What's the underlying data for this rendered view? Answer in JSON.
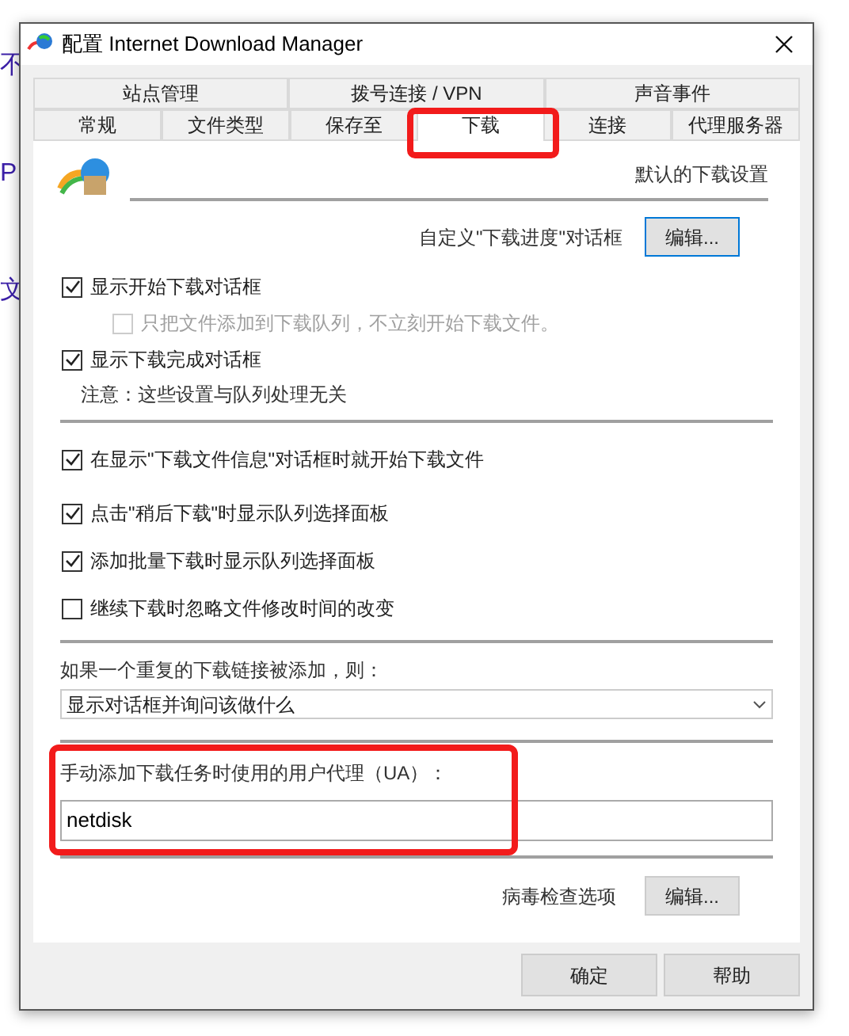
{
  "background_fragments": [
    "不",
    "P",
    "文"
  ],
  "window": {
    "title": "配置 Internet Download Manager"
  },
  "tab_rows": [
    [
      {
        "label": "站点管理",
        "selected": false,
        "highlighted": false
      },
      {
        "label": "拨号连接 / VPN",
        "selected": false,
        "highlighted": false
      },
      {
        "label": "声音事件",
        "selected": false,
        "highlighted": false
      }
    ],
    [
      {
        "label": "常规",
        "selected": false,
        "highlighted": false
      },
      {
        "label": "文件类型",
        "selected": false,
        "highlighted": false
      },
      {
        "label": "保存至",
        "selected": false,
        "highlighted": false
      },
      {
        "label": "下载",
        "selected": true,
        "highlighted": true
      },
      {
        "label": "连接",
        "selected": false,
        "highlighted": false
      },
      {
        "label": "代理服务器",
        "selected": false,
        "highlighted": false
      }
    ]
  ],
  "heading": "默认的下载设置",
  "progress_dialog": {
    "label": "自定义\"下载进度\"对话框",
    "button": "编辑...",
    "default": true
  },
  "group1": [
    {
      "label": "显示开始下载对话框",
      "checked": true,
      "disabled": false,
      "indented": false
    },
    {
      "label": "只把文件添加到下载队列，不立刻开始下载文件。",
      "checked": false,
      "disabled": true,
      "indented": true
    },
    {
      "label": "显示下载完成对话框",
      "checked": true,
      "disabled": false,
      "indented": false
    }
  ],
  "note": "注意：这些设置与队列处理无关",
  "group2": [
    {
      "label": "在显示\"下载文件信息\"对话框时就开始下载文件",
      "checked": true,
      "disabled": false,
      "indented": false
    },
    {
      "label": "点击\"稍后下载\"时显示队列选择面板",
      "checked": true,
      "disabled": false,
      "indented": false
    },
    {
      "label": "添加批量下载时显示队列选择面板",
      "checked": true,
      "disabled": false,
      "indented": false
    },
    {
      "label": "继续下载时忽略文件修改时间的改变",
      "checked": false,
      "disabled": false,
      "indented": false
    }
  ],
  "duplicate": {
    "label": "如果一个重复的下载链接被添加，则：",
    "value": "显示对话框并询问该做什么"
  },
  "ua": {
    "label": "手动添加下载任务时使用的用户代理（UA）：",
    "value": "netdisk",
    "highlighted": true
  },
  "virus": {
    "label": "病毒检查选项",
    "button": "编辑..."
  },
  "buttons": [
    "确定",
    "帮助"
  ]
}
